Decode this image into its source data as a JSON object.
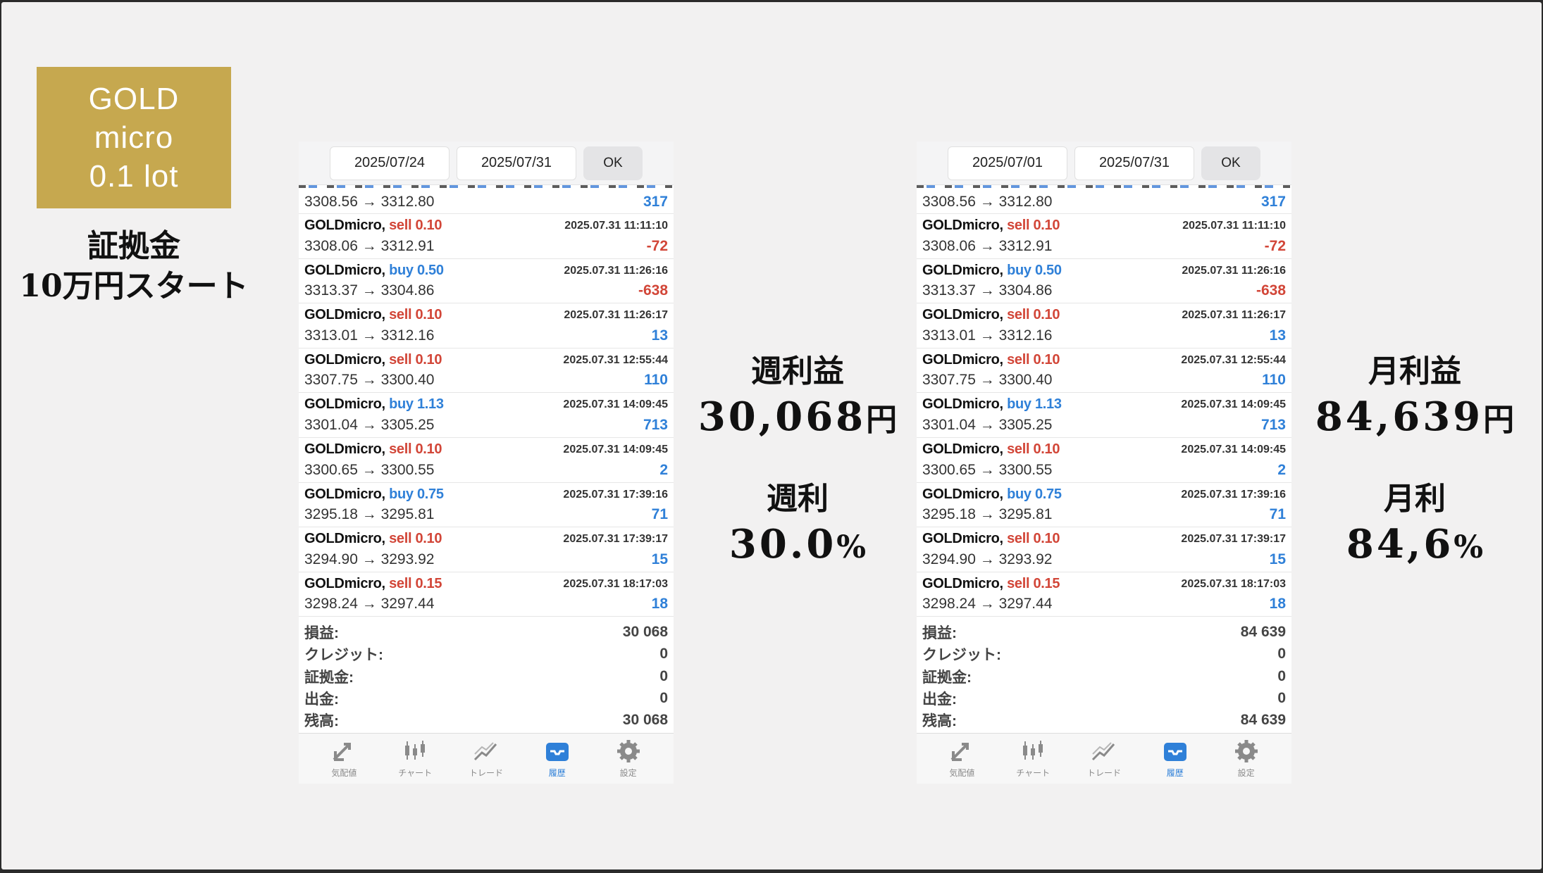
{
  "badge": {
    "lines": [
      "GOLD",
      "micro",
      "0.1 lot"
    ]
  },
  "deposit": {
    "line1": "証拠金",
    "line2": "10万円スタート"
  },
  "panels": [
    {
      "date_from": "2025/07/24",
      "date_to": "2025/07/31",
      "ok_label": "OK",
      "first_row": {
        "prices": "3308.56 → 3312.80",
        "profit": "317"
      },
      "trades": [
        {
          "symbol": "GOLDmicro,",
          "type": "sell 0.10",
          "side": "sell",
          "time": "2025.07.31 11:11:10",
          "prices": "3308.06 → 3312.91",
          "profit": "-72",
          "sign": "neg"
        },
        {
          "symbol": "GOLDmicro,",
          "type": "buy 0.50",
          "side": "buy",
          "time": "2025.07.31 11:26:16",
          "prices": "3313.37 → 3304.86",
          "profit": "-638",
          "sign": "neg"
        },
        {
          "symbol": "GOLDmicro,",
          "type": "sell 0.10",
          "side": "sell",
          "time": "2025.07.31 11:26:17",
          "prices": "3313.01 → 3312.16",
          "profit": "13",
          "sign": "pos"
        },
        {
          "symbol": "GOLDmicro,",
          "type": "sell 0.10",
          "side": "sell",
          "time": "2025.07.31 12:55:44",
          "prices": "3307.75 → 3300.40",
          "profit": "110",
          "sign": "pos"
        },
        {
          "symbol": "GOLDmicro,",
          "type": "buy 1.13",
          "side": "buy",
          "time": "2025.07.31 14:09:45",
          "prices": "3301.04 → 3305.25",
          "profit": "713",
          "sign": "pos"
        },
        {
          "symbol": "GOLDmicro,",
          "type": "sell 0.10",
          "side": "sell",
          "time": "2025.07.31 14:09:45",
          "prices": "3300.65 → 3300.55",
          "profit": "2",
          "sign": "pos"
        },
        {
          "symbol": "GOLDmicro,",
          "type": "buy 0.75",
          "side": "buy",
          "time": "2025.07.31 17:39:16",
          "prices": "3295.18 → 3295.81",
          "profit": "71",
          "sign": "pos"
        },
        {
          "symbol": "GOLDmicro,",
          "type": "sell 0.10",
          "side": "sell",
          "time": "2025.07.31 17:39:17",
          "prices": "3294.90 → 3293.92",
          "profit": "15",
          "sign": "pos"
        },
        {
          "symbol": "GOLDmicro,",
          "type": "sell 0.15",
          "side": "sell",
          "time": "2025.07.31 18:17:03",
          "prices": "3298.24 → 3297.44",
          "profit": "18",
          "sign": "pos"
        }
      ],
      "summary": [
        {
          "label": "損益:",
          "value": "30 068"
        },
        {
          "label": "クレジット:",
          "value": "0"
        },
        {
          "label": "証拠金:",
          "value": "0"
        },
        {
          "label": "出金:",
          "value": "0"
        },
        {
          "label": "残高:",
          "value": "30 068"
        }
      ]
    },
    {
      "date_from": "2025/07/01",
      "date_to": "2025/07/31",
      "ok_label": "OK",
      "first_row": {
        "prices": "3308.56 → 3312.80",
        "profit": "317"
      },
      "trades": [
        {
          "symbol": "GOLDmicro,",
          "type": "sell 0.10",
          "side": "sell",
          "time": "2025.07.31 11:11:10",
          "prices": "3308.06 → 3312.91",
          "profit": "-72",
          "sign": "neg"
        },
        {
          "symbol": "GOLDmicro,",
          "type": "buy 0.50",
          "side": "buy",
          "time": "2025.07.31 11:26:16",
          "prices": "3313.37 → 3304.86",
          "profit": "-638",
          "sign": "neg"
        },
        {
          "symbol": "GOLDmicro,",
          "type": "sell 0.10",
          "side": "sell",
          "time": "2025.07.31 11:26:17",
          "prices": "3313.01 → 3312.16",
          "profit": "13",
          "sign": "pos"
        },
        {
          "symbol": "GOLDmicro,",
          "type": "sell 0.10",
          "side": "sell",
          "time": "2025.07.31 12:55:44",
          "prices": "3307.75 → 3300.40",
          "profit": "110",
          "sign": "pos"
        },
        {
          "symbol": "GOLDmicro,",
          "type": "buy 1.13",
          "side": "buy",
          "time": "2025.07.31 14:09:45",
          "prices": "3301.04 → 3305.25",
          "profit": "713",
          "sign": "pos"
        },
        {
          "symbol": "GOLDmicro,",
          "type": "sell 0.10",
          "side": "sell",
          "time": "2025.07.31 14:09:45",
          "prices": "3300.65 → 3300.55",
          "profit": "2",
          "sign": "pos"
        },
        {
          "symbol": "GOLDmicro,",
          "type": "buy 0.75",
          "side": "buy",
          "time": "2025.07.31 17:39:16",
          "prices": "3295.18 → 3295.81",
          "profit": "71",
          "sign": "pos"
        },
        {
          "symbol": "GOLDmicro,",
          "type": "sell 0.10",
          "side": "sell",
          "time": "2025.07.31 17:39:17",
          "prices": "3294.90 → 3293.92",
          "profit": "15",
          "sign": "pos"
        },
        {
          "symbol": "GOLDmicro,",
          "type": "sell 0.15",
          "side": "sell",
          "time": "2025.07.31 18:17:03",
          "prices": "3298.24 → 3297.44",
          "profit": "18",
          "sign": "pos"
        }
      ],
      "summary": [
        {
          "label": "損益:",
          "value": "84 639"
        },
        {
          "label": "クレジット:",
          "value": "0"
        },
        {
          "label": "証拠金:",
          "value": "0"
        },
        {
          "label": "出金:",
          "value": "0"
        },
        {
          "label": "残高:",
          "value": "84 639"
        }
      ]
    }
  ],
  "tabs": [
    {
      "label": "気配値",
      "icon": "quotes-icon",
      "active": false
    },
    {
      "label": "チャート",
      "icon": "chart-icon",
      "active": false
    },
    {
      "label": "トレード",
      "icon": "trade-icon",
      "active": false
    },
    {
      "label": "履歴",
      "icon": "history-icon",
      "active": true
    },
    {
      "label": "設定",
      "icon": "settings-icon",
      "active": false
    }
  ],
  "weekly": {
    "profit_title": "週利益",
    "profit_value": "30,068",
    "profit_unit": "円",
    "rate_title": "週利",
    "rate_value": "30.0",
    "rate_unit": "%"
  },
  "monthly": {
    "profit_title": "月利益",
    "profit_value": "84,639",
    "profit_unit": "円",
    "rate_title": "月利",
    "rate_value": "84,6",
    "rate_unit": "%"
  },
  "colors": {
    "gold": "#c6a84f",
    "sell": "#d24638",
    "buy": "#2f80d8"
  }
}
